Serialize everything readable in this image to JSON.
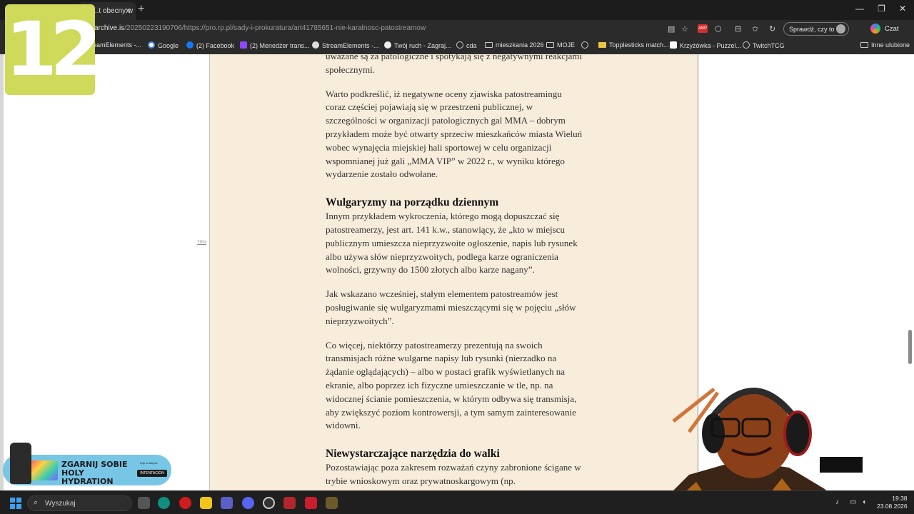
{
  "browser": {
    "tab_title": "...t obecny w",
    "tab_close": "✕",
    "new_tab": "+",
    "window_controls": [
      "—",
      "❐",
      "✕"
    ],
    "url_domain": "archive.is",
    "url_path": "/20250223190706/https://pro.rp.pl/sady-i-prokuratura/art41785651-nie-karalnosc-patostreamow",
    "abp_label": "ABP",
    "sprawdz_label": "Sprawdź, czy to Ty",
    "czat_label": "Czat",
    "icons": [
      "reader-icon",
      "favorite-star-icon",
      "adblock-icon",
      "extensions-icon",
      "split-screen-icon",
      "favorites-icon",
      "history-icon"
    ]
  },
  "bookmarks": [
    {
      "label": "eamElements -...",
      "icon": "streamelements-icon"
    },
    {
      "label": "Google",
      "icon": "google-icon"
    },
    {
      "label": "(2) Facebook",
      "icon": "facebook-icon"
    },
    {
      "label": "(2) Menedżer trans...",
      "icon": "twitch-icon"
    },
    {
      "label": "StreamElements -...",
      "icon": "streamelements-icon"
    },
    {
      "label": "Twój ruch - Zagraj...",
      "icon": "chess-icon"
    },
    {
      "label": "cda",
      "icon": "globe-icon"
    },
    {
      "label": "mieszkania 2026",
      "icon": "folder-icon"
    },
    {
      "label": "MOJE",
      "icon": "folder-icon"
    },
    {
      "label": "",
      "icon": "globe-icon"
    },
    {
      "label": "Topplesticks match...",
      "icon": "folder-icon"
    },
    {
      "label": "Krzyżówka - Puzzel...",
      "icon": "puzzel-icon"
    },
    {
      "label": "TwitchTCG",
      "icon": "globe-icon"
    }
  ],
  "other_bookmarks": "Inne ulubione",
  "article": {
    "p0": "uważane są za patologiczne i spotykają się z negatywnymi reakcjami społecznymi.",
    "p1": "Warto podkreślić, iż negatywne oceny zjawiska patostreamingu coraz częściej pojawiają się w przestrzeni publicznej, w szczególności w organizacji patologicznych gal MMA – dobrym przykładem może być otwarty sprzeciw mieszkańców miasta Wieluń wobec wynajęcia miejskiej hali sportowej w celu organizacji wspomnianej już gali „MMA VIP” w 2022 r., w wyniku którego wydarzenie zostało odwołane.",
    "h1": "Wulgaryzmy na porządku dziennym",
    "p2": "Innym przykładem wykroczenia, którego mogą dopuszczać się patostreamerzy, jest art. 141 k.w., stanowiący, że „kto w miejscu publicznym umieszcza nieprzyzwoite ogłoszenie, napis lub rysunek albo używa słów nieprzyzwoitych, podlega karze ograniczenia wolności, grzywny do 1500 złotych albo karze nagany”.",
    "p3": "Jak wskazano wcześniej, stałym elementem patostreamów jest posługiwanie się wulgaryzmami mieszczącymi się w pojęciu „słów nieprzyzwoitych”.",
    "p4": "Co więcej, niektórzy patostreamerzy prezentują na swoich transmisjach różne wulgarne napisy lub rysunki (nierzadko na żądanie oglądających) – albo w postaci grafik wyświetlanych na ekranie, albo poprzez ich fizyczne umieszczanie w tle, np. na widocznej ścianie pomieszczenia, w którym odbywa się transmisja, aby zwiększyć poziom kontrowersji, a tym samym zainteresowanie widowni.",
    "h2": "Niewystarczające narzędzia do walki",
    "p5": "Pozostawiając poza zakresem rozważań czyny zabronione ścigane w trybie wnioskowym oraz prywatnoskargowym (np."
  },
  "zoom_label": "70%",
  "overlay": {
    "badge": "12",
    "ad_title": "ZGARNIJ SOBIE HOLY HYDRATION",
    "ad_small": "Kup w sklepie",
    "ad_brand": "INTENTACION"
  },
  "taskbar": {
    "search_placeholder": "Wyszukaj",
    "clock_time": "19:38",
    "clock_date": "23.08.2026",
    "apps": [
      "task-view-icon",
      "edge-icon",
      "opera-icon",
      "file-explorer-icon",
      "teams-icon",
      "discord-icon",
      "obs-icon",
      "app-icon",
      "app-icon",
      "app-icon"
    ]
  }
}
